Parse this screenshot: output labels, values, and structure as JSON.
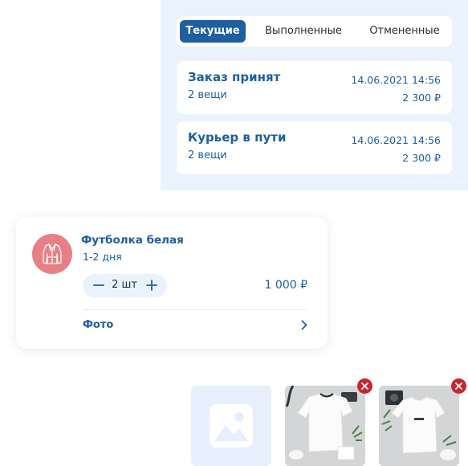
{
  "orders": {
    "tabs": [
      {
        "label": "Текущие",
        "active": true
      },
      {
        "label": "Выполненные",
        "active": false
      },
      {
        "label": "Отмененные",
        "active": false
      }
    ],
    "list": [
      {
        "status": "Заказ принят",
        "items": "2 вещи",
        "date": "14.06.2021 14:56",
        "price": "2 300 ₽"
      },
      {
        "status": "Курьер в пути",
        "items": "2 вещи",
        "date": "14.06.2021 14:56",
        "price": "2 300 ₽"
      }
    ]
  },
  "product": {
    "icon": "jacket-icon",
    "title": "Футболка белая",
    "delivery": "1-2 дня",
    "quantity": "2 шт",
    "price": "1 000 ₽",
    "photo_label": "Фото"
  },
  "photos": {
    "placeholder_icon": "image-placeholder-icon",
    "remove_icon": "close-icon",
    "items": [
      "photo-tshirt-1",
      "photo-tshirt-2"
    ]
  },
  "colors": {
    "primary": "#1f5ea0",
    "panel_bg": "#eaf2fd",
    "avatar_bg": "#e97f86",
    "remove": "#c6262e"
  }
}
